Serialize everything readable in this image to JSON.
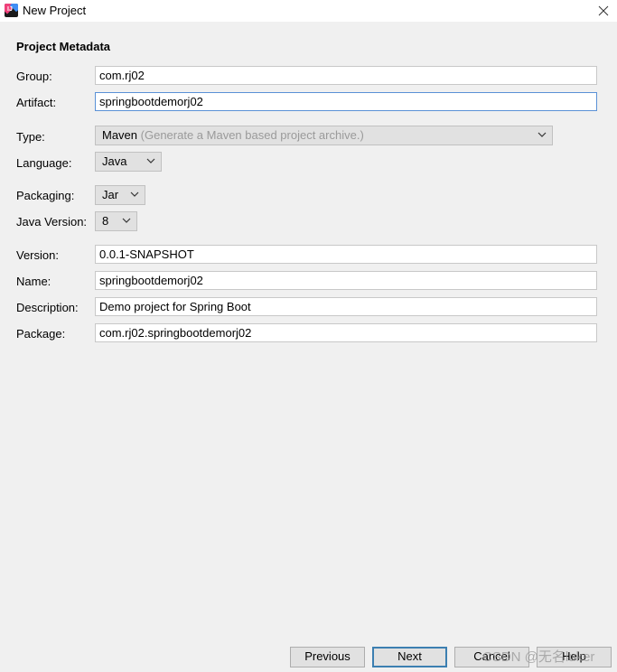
{
  "window": {
    "title": "New Project"
  },
  "section": {
    "title": "Project Metadata"
  },
  "group": {
    "label": "Group:",
    "value": "com.rj02"
  },
  "artifact": {
    "label": "Artifact:",
    "value": "springbootdemorj02"
  },
  "type": {
    "label": "Type:",
    "value": "Maven",
    "hint": "(Generate a Maven based project archive.)"
  },
  "language": {
    "label": "Language:",
    "value": "Java"
  },
  "packaging": {
    "label": "Packaging:",
    "value": "Jar"
  },
  "java_version": {
    "label": "Java Version:",
    "value": "8"
  },
  "version": {
    "label": "Version:",
    "value": "0.0.1-SNAPSHOT"
  },
  "name": {
    "label": "Name:",
    "value": "springbootdemorj02"
  },
  "description": {
    "label": "Description:",
    "value": "Demo project for Spring Boot"
  },
  "package": {
    "label": "Package:",
    "value": "com.rj02.springbootdemorj02"
  },
  "buttons": {
    "previous": "Previous",
    "next": "Next",
    "cancel": "Cancel",
    "help": "Help"
  },
  "watermark": "CSDN @无名luker"
}
